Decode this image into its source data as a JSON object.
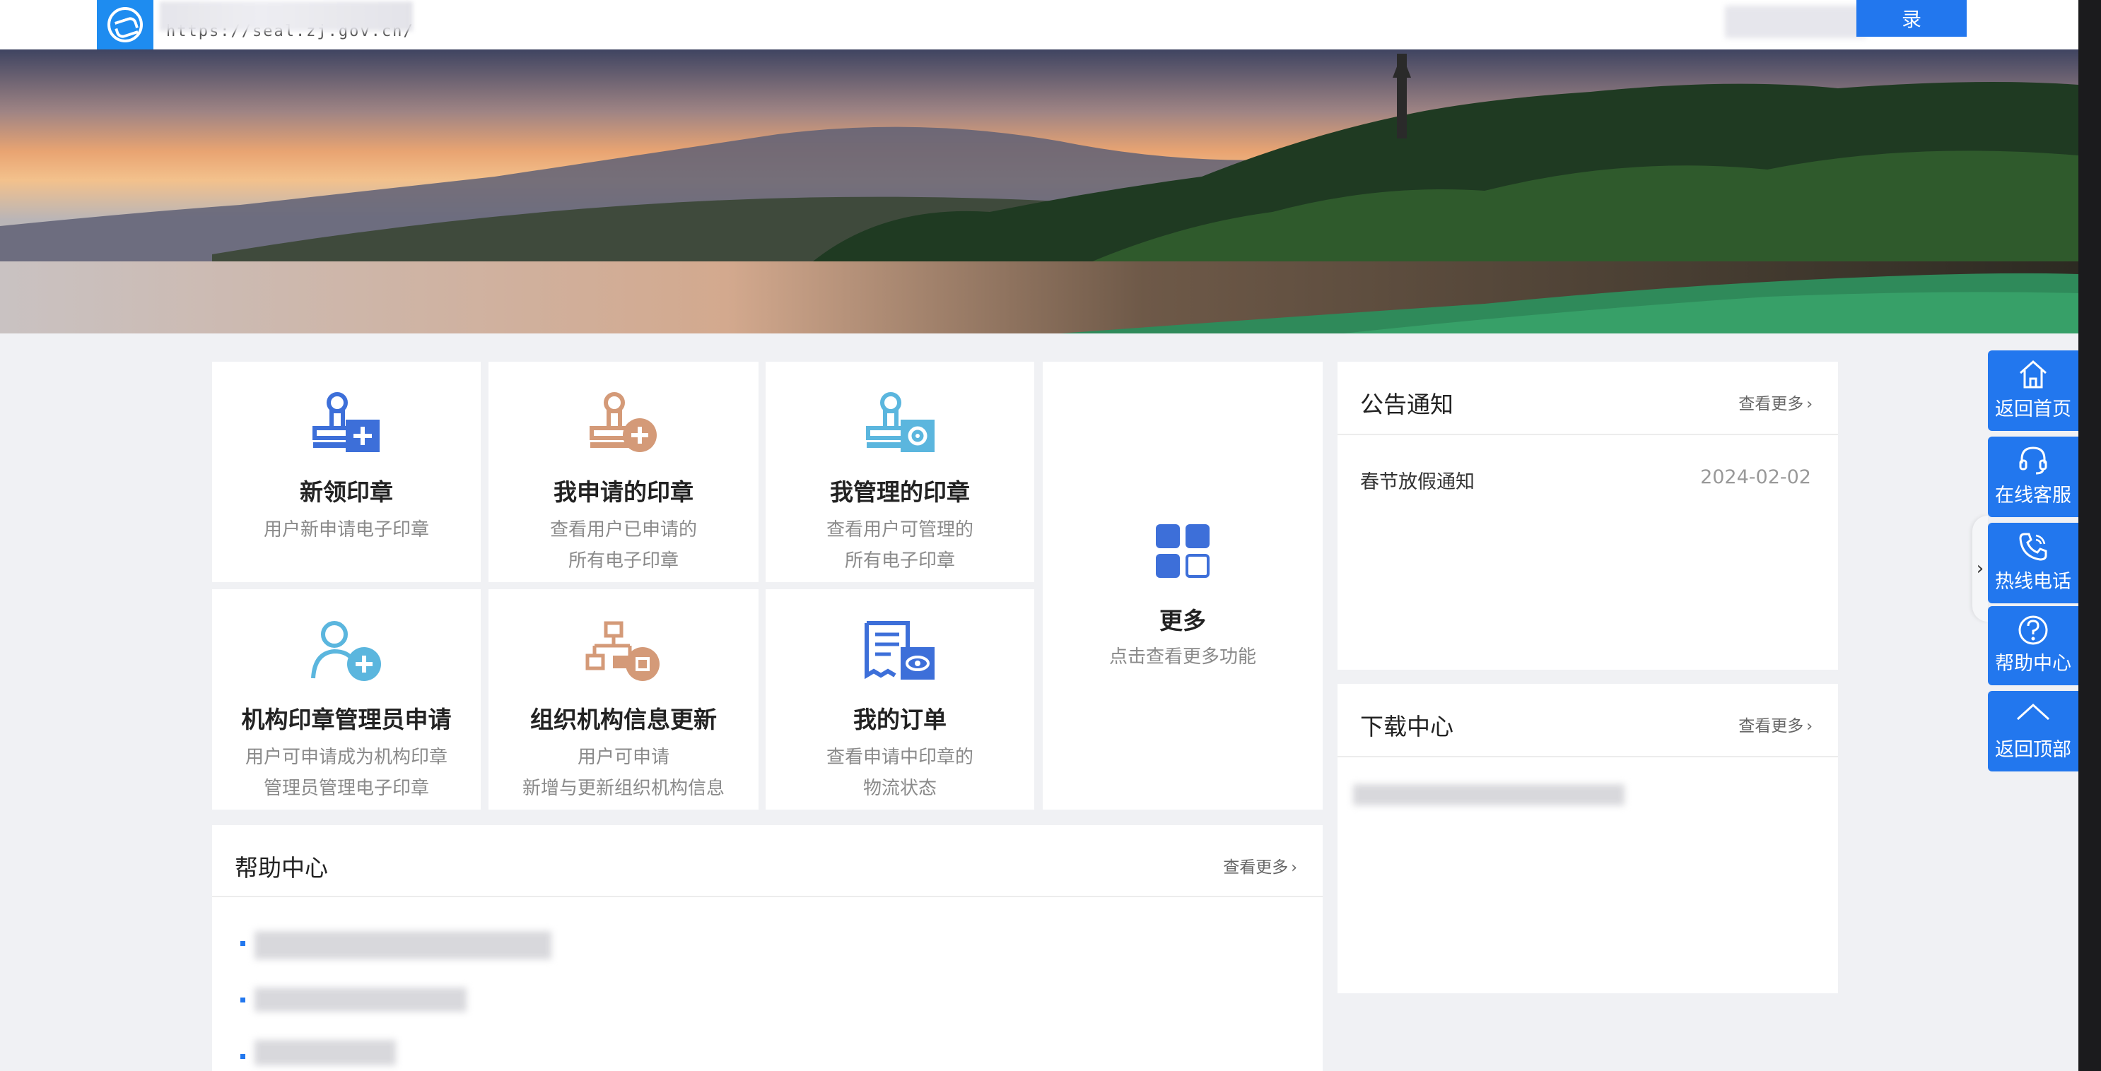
{
  "header": {
    "url": "https://seal.zj.gov.cn/",
    "login_label": "录"
  },
  "services": [
    {
      "title": "新领印章",
      "desc": [
        "用户新申请电子印章"
      ],
      "icon": "seal-add-icon",
      "color": "#3d6fd9"
    },
    {
      "title": "我申请的印章",
      "desc": [
        "查看用户已申请的",
        "所有电子印章"
      ],
      "icon": "seal-add-icon",
      "color": "#d49a78"
    },
    {
      "title": "我管理的印章",
      "desc": [
        "查看用户可管理的",
        "所有电子印章"
      ],
      "icon": "seal-settings-icon",
      "color": "#5bb6de"
    },
    {
      "title": "机构印章管理员申请",
      "desc": [
        "用户可申请成为机构印章",
        "管理员管理电子印章"
      ],
      "icon": "user-add-icon",
      "color": "#5bb6de"
    },
    {
      "title": "组织机构信息更新",
      "desc": [
        "用户可申请",
        "新增与更新组织机构信息"
      ],
      "icon": "org-chart-icon",
      "color": "#d49a78"
    },
    {
      "title": "我的订单",
      "desc": [
        "查看申请中印章的",
        "物流状态"
      ],
      "icon": "order-view-icon",
      "color": "#3d6fd9"
    },
    {
      "title": "更多",
      "desc": [
        "点击查看更多功能"
      ],
      "icon": "grid-icon",
      "color": "#3d6fd9"
    }
  ],
  "notice": {
    "title": "公告通知",
    "more": "查看更多",
    "items": [
      {
        "text": "春节放假通知",
        "date": "2024-02-02"
      }
    ]
  },
  "downloads": {
    "title": "下载中心",
    "more": "查看更多"
  },
  "help": {
    "title": "帮助中心",
    "more": "查看更多"
  },
  "float_bar": [
    {
      "label": "返回首页",
      "icon": "home-icon"
    },
    {
      "label": "在线客服",
      "icon": "headset-icon"
    },
    {
      "label": "热线电话",
      "icon": "phone-icon"
    },
    {
      "label": "帮助中心",
      "icon": "question-icon"
    },
    {
      "label": "返回顶部",
      "icon": "chevron-up-icon"
    }
  ],
  "colors": {
    "accent": "#2277ee",
    "logo": "#1e8cf0",
    "muted": "#8a8a8a"
  }
}
